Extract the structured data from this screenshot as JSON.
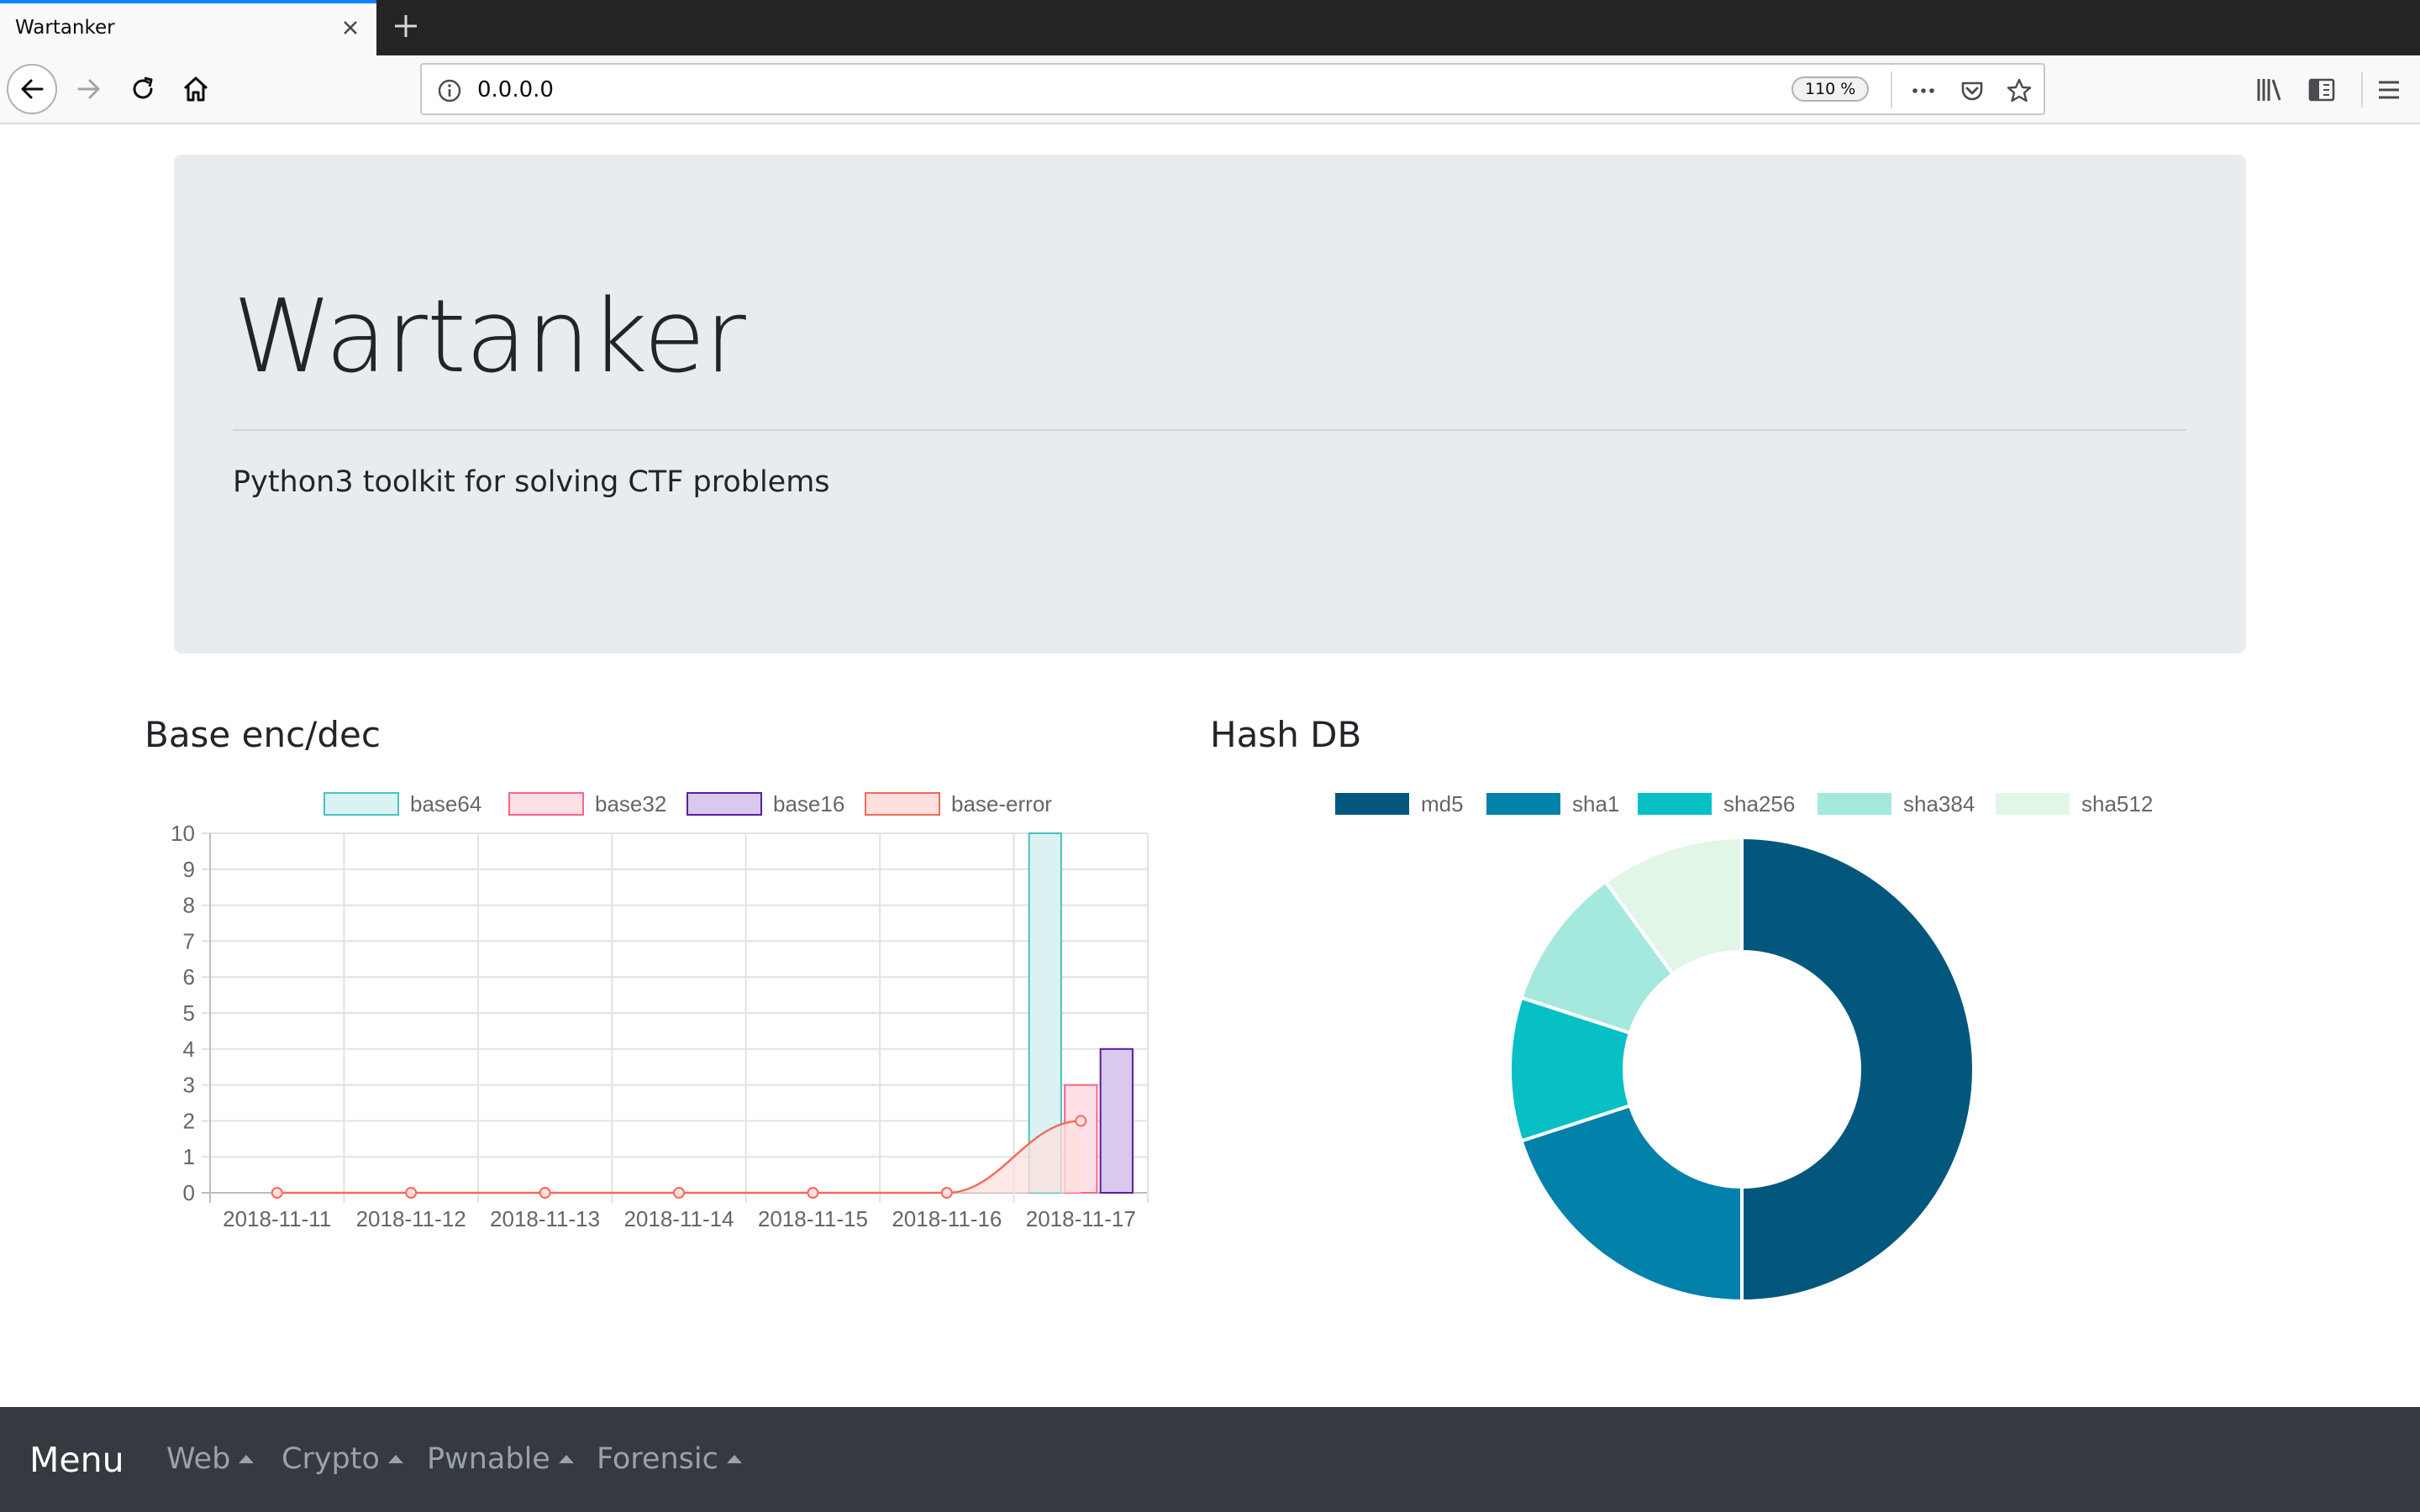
{
  "browser": {
    "tab_title": "Wartanker",
    "url": "0.0.0.0",
    "zoom": "110 %"
  },
  "jumbotron": {
    "title": "Wartanker",
    "lead": "Python3 toolkit for solving CTF problems"
  },
  "sections": {
    "base_title": "Base enc/dec",
    "hash_title": "Hash DB"
  },
  "footer": {
    "brand": "Menu",
    "items": [
      "Web",
      "Crypto",
      "Pwnable",
      "Forensic"
    ]
  },
  "chart_data": [
    {
      "type": "bar",
      "categories": [
        "2018-11-11",
        "2018-11-12",
        "2018-11-13",
        "2018-11-14",
        "2018-11-15",
        "2018-11-16",
        "2018-11-17"
      ],
      "ylim": [
        0,
        10
      ],
      "yticks": [
        0,
        1,
        2,
        3,
        4,
        5,
        6,
        7,
        8,
        9,
        10
      ],
      "grid": true,
      "legend_position": "top",
      "series": [
        {
          "name": "base64",
          "kind": "bar",
          "values": [
            0,
            0,
            0,
            0,
            0,
            0,
            10
          ],
          "fill": "#dbf2f2",
          "stroke": "#4bc0c0"
        },
        {
          "name": "base32",
          "kind": "bar",
          "values": [
            0,
            0,
            0,
            0,
            0,
            0,
            3
          ],
          "fill": "#ffe0e6",
          "stroke": "#ff6384"
        },
        {
          "name": "base16",
          "kind": "bar",
          "values": [
            0,
            0,
            0,
            0,
            0,
            0,
            4
          ],
          "fill": "#d9c9ed",
          "stroke": "#5a1e9e"
        },
        {
          "name": "base-error",
          "kind": "line",
          "values": [
            0,
            0,
            0,
            0,
            0,
            0,
            2
          ],
          "fill": "#fde0dd",
          "stroke": "#f26b5b"
        }
      ]
    },
    {
      "type": "pie",
      "variant": "doughnut",
      "legend_position": "top",
      "labels": [
        "md5",
        "sha1",
        "sha256",
        "sha384",
        "sha512"
      ],
      "values": [
        50,
        20,
        10,
        10,
        10
      ],
      "colors": [
        "#03577c",
        "#0281ab",
        "#06c0c6",
        "#a5e8de",
        "#e2f6e8"
      ]
    }
  ]
}
